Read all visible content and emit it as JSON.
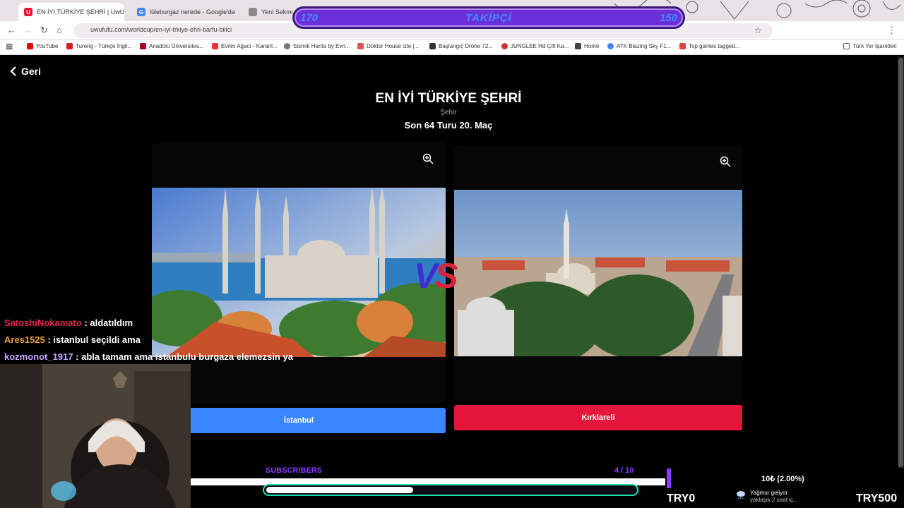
{
  "browser": {
    "tabs": [
      {
        "label": "EN İYİ TÜRKİYE ŞEHRİ | UwUFUFU",
        "active": true
      },
      {
        "label": "lüleburgaz nerede - Google'da",
        "active": false
      },
      {
        "label": "Yeni Sekme",
        "active": false
      }
    ],
    "url": "uwufufu.com/worldcup/en-iyi-trkiye-ehri-barfu-bilici",
    "bookmarks": [
      "YouTube",
      "Tureng - Türkçe İngil...",
      "Anadolu Üniversites...",
      "Evrim Ağacı - Karanl...",
      "Sismik Harita by Evri...",
      "Doktor House izle |...",
      "Başlangıç Drone 72...",
      "JUNGLEE Hd Çift Ka...",
      "Home",
      "ATK Blazing Sky F1...",
      "Top games tagged..."
    ],
    "bookmarks_folder": "Tüm Yer İşaretleri"
  },
  "follower_goal": {
    "left": "170",
    "label": "TAKİPÇİ",
    "right": "150"
  },
  "page": {
    "back_label": "Geri",
    "title": "EN İYİ TÜRKİYE ŞEHRİ",
    "category": "Şehir",
    "round": "Son 64 Turu 20. Maç",
    "left_choice": "İstanbul",
    "right_choice": "Kırklareli",
    "vs_v": "V",
    "vs_s": "S"
  },
  "chat": [
    {
      "user": "SatoshiNokamato",
      "color": "#e0284f",
      "message": ": aldatıldım"
    },
    {
      "user": "Ares1525",
      "color": "#e8a23a",
      "message": ": istanbul seçildi ama"
    },
    {
      "user": "kozmonot_1917",
      "color": "#c9a6ff",
      "message": ": abla tamam ama istanbulu burgaza elemezsin ya"
    }
  ],
  "subscribers": {
    "label": "SUBSCRIBERS",
    "count": "4 / 10",
    "progress": 0.4
  },
  "donation": {
    "text": "10₺ (2.00%)",
    "left_label": "TRY0",
    "right_label": "TRY500"
  },
  "weather": {
    "line1": "Yağmur geliyor",
    "line2": "yaklaşık 2 saat iç..."
  },
  "colors": {
    "left_button": "#3a86ff",
    "right_button": "#e5163a",
    "accent": "#8a3cff"
  }
}
